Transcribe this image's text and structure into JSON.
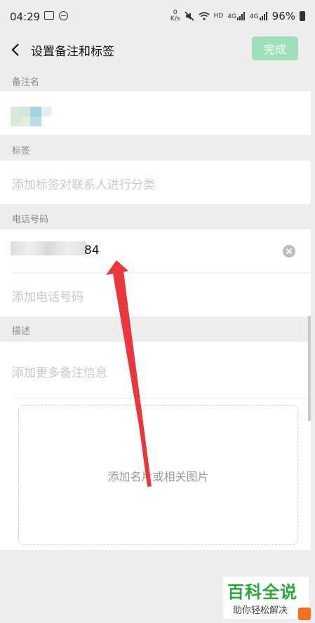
{
  "status_bar": {
    "time": "04:29",
    "net_speed_top": "0",
    "net_speed_unit": "K/s",
    "hd_label": "HD",
    "signal_labels": [
      "4G",
      "4G"
    ],
    "battery": "96%"
  },
  "header": {
    "title": "设置备注和标签",
    "done_label": "完成"
  },
  "remark": {
    "label": "备注名"
  },
  "tags": {
    "label": "标签",
    "placeholder": "添加标签对联系人进行分类"
  },
  "phone": {
    "label": "电话号码",
    "value_visible": "84",
    "add_placeholder": "添加电话号码"
  },
  "description": {
    "label": "描述",
    "placeholder": "添加更多备注信息",
    "photo_placeholder": "添加名片或相关图片"
  },
  "watermark": {
    "title": "百科全说",
    "subtitle": "助你轻松解决"
  },
  "colors": {
    "accent": "#9de0b9",
    "arrow": "#e8383d",
    "background": "#ededed"
  }
}
